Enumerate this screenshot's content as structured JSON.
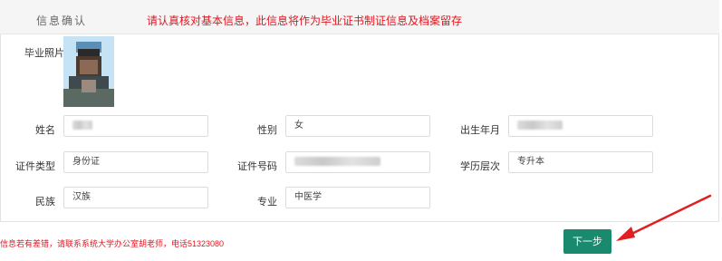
{
  "header": {
    "title": "信息确认",
    "notice": "请认真核对基本信息，此信息将作为毕业证书制证信息及档案留存"
  },
  "photo": {
    "label": "毕业照片"
  },
  "fields": {
    "name": {
      "label": "姓名",
      "value": ""
    },
    "gender": {
      "label": "性别",
      "value": "女"
    },
    "birth": {
      "label": "出生年月",
      "value": ""
    },
    "id_type": {
      "label": "证件类型",
      "value": "身份证"
    },
    "id_number": {
      "label": "证件号码",
      "value": ""
    },
    "education": {
      "label": "学历层次",
      "value": "专升本"
    },
    "ethnicity": {
      "label": "民族",
      "value": "汉族"
    },
    "major": {
      "label": "专业",
      "value": "中医学"
    }
  },
  "footer": {
    "notice": "信息若有差错，请联系系统大学办公室胡老师，电话51323080",
    "next_label": "下一步"
  },
  "colors": {
    "notice_red": "#e4151f",
    "button_green": "#1a8a6e",
    "arrow_red": "#e02020"
  }
}
